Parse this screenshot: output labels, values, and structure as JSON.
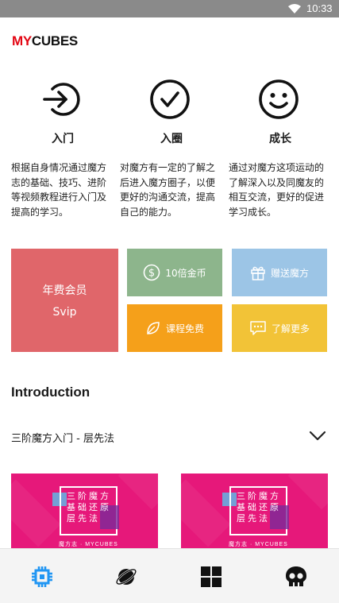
{
  "status_bar": {
    "time": "10:33",
    "icon": "wifi-icon"
  },
  "app": {
    "logo_my": "MY",
    "logo_cubes": "CUBES",
    "logo_my_color": "#e30613"
  },
  "features": [
    {
      "icon": "enter-arrow-icon",
      "title": "入门",
      "desc": "根据自身情况通过魔方志的基础、技巧、进阶等视频教程进行入门及提高的学习。"
    },
    {
      "icon": "check-circle-icon",
      "title": "入圈",
      "desc": "对魔方有一定的了解之后进入魔方圈子，以便更好的沟通交流，提高自己的能力。"
    },
    {
      "icon": "smiley-icon",
      "title": "成长",
      "desc": "通过对魔方这项运动的了解深入以及同魔友的相互交流，更好的促进学习成长。"
    }
  ],
  "promo": {
    "vip": {
      "line1": "年费会员",
      "line2": "Svip",
      "color": "#e0666a"
    },
    "coins": {
      "icon": "dollar-circle-icon",
      "label": "10倍金币",
      "color": "#8db58c"
    },
    "gift": {
      "icon": "gift-icon",
      "label": "赠送魔方",
      "color": "#9cc5e6"
    },
    "course": {
      "icon": "leaf-icon",
      "label": "课程免费",
      "color": "#f5a01a"
    },
    "more": {
      "icon": "chat-dots-icon",
      "label": "了解更多",
      "color": "#f2c337"
    }
  },
  "section": {
    "title": "Introduction"
  },
  "course_selector": {
    "label": "三阶魔方入门 - 层先法",
    "icon": "chevron-down-icon"
  },
  "thumbnails": [
    {
      "text": "三阶魔方基础还原层先法",
      "brand": "魔方志 · MYCUBES",
      "color": "#e6187a"
    },
    {
      "text": "三阶魔方基础还原层先法",
      "brand": "魔方志 · MYCUBES",
      "color": "#e6187a"
    }
  ],
  "bottom_nav": [
    {
      "icon": "chip-icon",
      "active": true,
      "color": "#2196f3"
    },
    {
      "icon": "planet-icon",
      "active": false
    },
    {
      "icon": "grid-icon",
      "active": false
    },
    {
      "icon": "skull-icon",
      "active": false
    }
  ]
}
